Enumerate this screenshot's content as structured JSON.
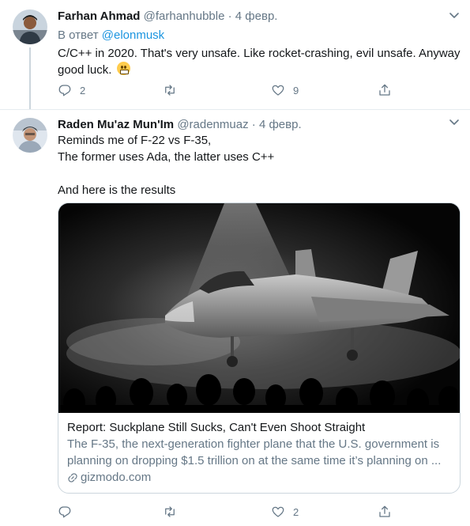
{
  "tweets": [
    {
      "name": "Farhan Ahmad",
      "handle": "@farhanhubble",
      "sep": "·",
      "date": "4 февр.",
      "reply_prefix": "В ответ",
      "reply_to": "@elonmusk",
      "text": "C/C++ in 2020. That's very unsafe. Like rocket-crashing, evil unsafe. Anyway good luck.",
      "emoji": "grimacing-face",
      "replies": "2",
      "retweets": "",
      "likes": "9"
    },
    {
      "name": "Raden Mu'az Mun'Im",
      "handle": "@radenmuaz",
      "sep": "·",
      "date": "4 февр.",
      "text_lines": [
        "Reminds me of F-22 vs F-35,",
        "The former uses Ada, the latter uses C++",
        "",
        "And here is the results"
      ],
      "card": {
        "title": "Report: Suckplane Still Sucks, Can't Even Shoot Straight",
        "description_line1": "The F-35, the next-generation fighter plane that the U.S. government is",
        "description_line2": "planning on dropping $1.5 trillion on at the same time it’s planning on ...",
        "site": "gizmodo.com"
      },
      "replies": "",
      "retweets": "",
      "likes": "2"
    }
  ],
  "colors": {
    "text": "#14171a",
    "muted": "#657786",
    "link": "#1b95e0",
    "border": "#ccd6dd"
  }
}
